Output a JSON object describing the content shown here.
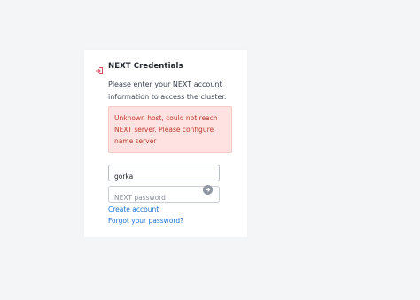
{
  "login_card": {
    "icon": "sign-in-icon",
    "title": "NEXT Credentials",
    "description": "Please enter your NEXT account information to access the cluster.",
    "error_message": "Unknown host, could not reach NEXT server. Please configure name server",
    "username_value": "gorka",
    "password_placeholder": "NEXT password",
    "create_account_link": "Create account",
    "forgot_password_link": "Forgot your password?"
  },
  "colors": {
    "error_text": "#c0392b",
    "error_bg": "#fde2e1",
    "link": "#1a73d9",
    "icon_accent": "#e0455a"
  }
}
